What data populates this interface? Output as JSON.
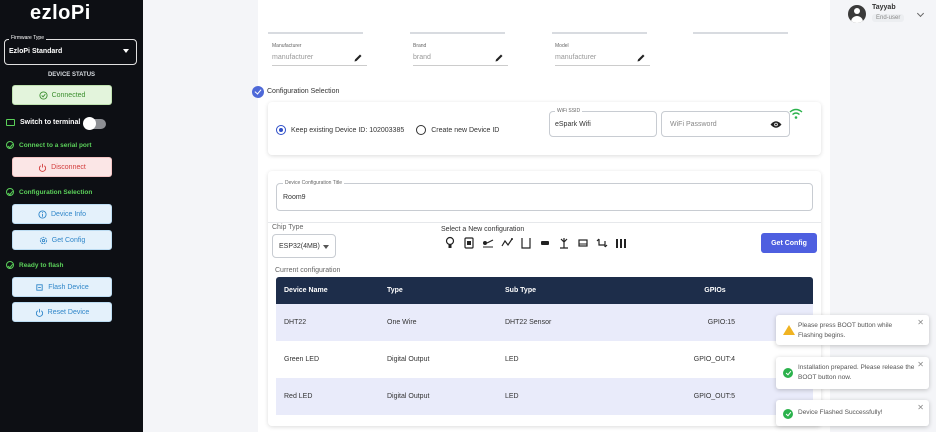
{
  "sidebar": {
    "logo": "ezloPi",
    "firmware_legend": "Firmware Type",
    "firmware_value": "EzloPi Standard",
    "device_status_heading": "DEVICE STATUS",
    "connected_label": "Connected",
    "switch_terminal_label": "Switch to terminal",
    "connect_serial_label": "Connect to a serial port",
    "disconnect_label": "Disconnect",
    "config_selection_label": "Configuration Selection",
    "device_info_label": "Device Info",
    "get_config_label": "Get Config",
    "ready_flash_label": "Ready to flash",
    "flash_device_label": "Flash Device",
    "reset_device_label": "Reset Device"
  },
  "header": {
    "user_name": "Tayyab",
    "user_role": "End-user"
  },
  "device_fields": [
    {
      "label": "Manufacturer",
      "placeholder": "manufacturer"
    },
    {
      "label": "Brand",
      "placeholder": "brand"
    },
    {
      "label": "Model",
      "placeholder": "manufacturer"
    }
  ],
  "config": {
    "step_title": "Configuration Selection",
    "keep_existing_label": "Keep existing Device ID: 102003385",
    "create_new_label": "Create new Device ID",
    "wifi_ssid_legend": "WiFi SSID",
    "wifi_ssid_value": "eSpark Wifi",
    "wifi_password_placeholder": "WiFi Password"
  },
  "device_config": {
    "title_legend": "Device Configuration Title",
    "title_value": "Room9",
    "chip_type_label": "Chip Type",
    "chip_type_value": "ESP32(4MB)",
    "select_new_label": "Select a New configuration",
    "get_config_button": "Get Config",
    "current_config_label": "Current configuration",
    "device_icons": [
      "bulb-icon",
      "plug-icon",
      "switch-icon",
      "dimmer-icon",
      "relay-icon",
      "button-icon",
      "lamp-icon",
      "panel-icon",
      "swap-icon",
      "sensor-group-icon"
    ]
  },
  "table": {
    "headers": [
      "Device Name",
      "Type",
      "Sub Type",
      "GPIOs"
    ],
    "rows": [
      [
        "DHT22",
        "One Wire",
        "DHT22 Sensor",
        "GPIO:15"
      ],
      [
        "Green LED",
        "Digital Output",
        "LED",
        "GPIO_OUT:4"
      ],
      [
        "Red LED",
        "Digital Output",
        "LED",
        "GPIO_OUT:5"
      ]
    ]
  },
  "toasts": [
    {
      "type": "warning",
      "text": "Please press BOOT button while Flashing begins."
    },
    {
      "type": "success",
      "text": "Installation prepared. Please release the BOOT button now."
    },
    {
      "type": "success",
      "text": "Device Flashed Successfully!"
    }
  ],
  "colors": {
    "sidebar_bg": "#0d0f14",
    "primary": "#4e5fe0",
    "table_header": "#1d2d4a",
    "success": "#2bb24c",
    "warning": "#f0b322"
  }
}
